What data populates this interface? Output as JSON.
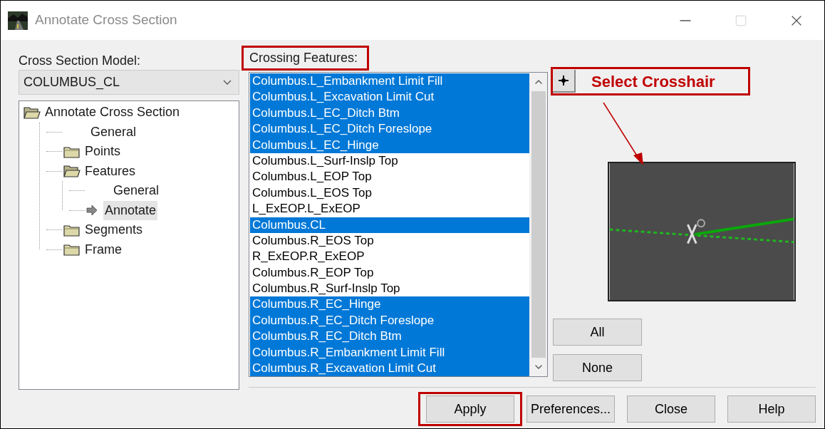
{
  "window": {
    "title": "Annotate Cross Section",
    "controls": [
      {
        "kind": "minimize",
        "disabled": false
      },
      {
        "kind": "maximize",
        "disabled": true
      },
      {
        "kind": "close",
        "disabled": false
      }
    ]
  },
  "model": {
    "label": "Cross Section Model:",
    "value": "COLUMBUS_CL"
  },
  "tree": [
    {
      "label": "Annotate Cross Section",
      "kind": "folder",
      "expanded": true,
      "selected": false,
      "children": [
        {
          "label": "General",
          "kind": "leaf",
          "selected": false
        },
        {
          "label": "Points",
          "kind": "folder",
          "expanded": false,
          "selected": false
        },
        {
          "label": "Features",
          "kind": "folder",
          "expanded": true,
          "selected": false,
          "children": [
            {
              "label": "General",
              "kind": "leaf",
              "selected": false
            },
            {
              "label": "Annotate",
              "kind": "current",
              "selected": true
            }
          ]
        },
        {
          "label": "Segments",
          "kind": "folder",
          "expanded": false,
          "selected": false
        },
        {
          "label": "Frame",
          "kind": "folder",
          "expanded": false,
          "selected": false
        }
      ]
    }
  ],
  "crossing_features": {
    "label": "Crossing Features:",
    "highlighted": true,
    "items": [
      {
        "label": "Columbus.L_Embankment Limit Fill",
        "selected": true
      },
      {
        "label": "Columbus.L_Excavation Limit Cut",
        "selected": true
      },
      {
        "label": "Columbus.L_EC_Ditch Btm",
        "selected": true
      },
      {
        "label": "Columbus.L_EC_Ditch Foreslope",
        "selected": true
      },
      {
        "label": "Columbus.L_EC_Hinge",
        "selected": true
      },
      {
        "label": "Columbus.L_Surf-Inslp Top",
        "selected": false
      },
      {
        "label": "Columbus.L_EOP Top",
        "selected": false
      },
      {
        "label": "Columbus.L_EOS Top",
        "selected": false
      },
      {
        "label": "L_ExEOP.L_ExEOP",
        "selected": false
      },
      {
        "label": "Columbus.CL",
        "selected": true
      },
      {
        "label": "Columbus.R_EOS Top",
        "selected": false
      },
      {
        "label": "R_ExEOP.R_ExEOP",
        "selected": false
      },
      {
        "label": "Columbus.R_EOP Top",
        "selected": false
      },
      {
        "label": "Columbus.R_Surf-Inslp Top",
        "selected": false
      },
      {
        "label": "Columbus.R_EC_Hinge",
        "selected": true
      },
      {
        "label": "Columbus.R_EC_Ditch Foreslope",
        "selected": true
      },
      {
        "label": "Columbus.R_EC_Ditch Btm",
        "selected": true
      },
      {
        "label": "Columbus.R_Embankment Limit Fill",
        "selected": true
      },
      {
        "label": "Columbus.R_Excavation Limit Cut",
        "selected": true
      }
    ]
  },
  "crosshair": {
    "callout": "Select Crosshair",
    "highlighted": true
  },
  "selection_buttons": [
    "All",
    "None"
  ],
  "buttons": [
    {
      "label": "Apply",
      "highlighted": true
    },
    {
      "label": "Preferences...",
      "highlighted": false
    },
    {
      "label": "Close",
      "highlighted": false
    },
    {
      "label": "Help",
      "highlighted": false
    }
  ]
}
